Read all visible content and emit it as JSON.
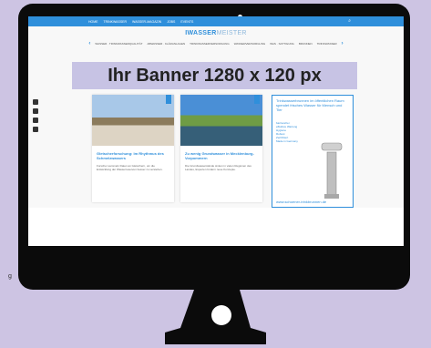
{
  "colors": {
    "brand": "#2f8fdb",
    "banner_bg": "#c7c3e4",
    "page_bg": "#cdc4e3"
  },
  "topbar": {
    "items": [
      "HOME",
      "TRINKWASSER",
      "WASSER-MAGAZIN",
      "JOBS",
      "EVENTS"
    ]
  },
  "site": {
    "logo_bold": "WASSER",
    "logo_thin": "MEISTER",
    "logo_prefix": "I"
  },
  "catnav": {
    "items": [
      "WASSER · TRINKWASSERQUALITÄT",
      "ABWASSER · KLÄRANLAGEN",
      "TRINKWASSERVERSORGUNG",
      "WASSERVERSORGUNG",
      "WAS · SATTIGUNG",
      "BRUNNEN",
      "TRINKWASSER"
    ]
  },
  "banner": {
    "label": "Ihr Banner 1280 x 120 px"
  },
  "social": {
    "icons": [
      "facebook-icon",
      "twitter-icon",
      "linkedin-icon",
      "xing-icon"
    ]
  },
  "cards": [
    {
      "title": "Gletscherforschung: Im Rhythmus des Schmelzwassers",
      "excerpt": "Forscher sammeln Daten an Gletschern, um die Entwicklung der Wasserreserven besser zu verstehen."
    },
    {
      "title": "Zu wenig Grundwasser in Mecklenburg-Vorpommern",
      "excerpt": "Die Grundwasserstände sinken in vielen Regionen des Landes, Experten fordern neue Konzepte."
    }
  ],
  "ad": {
    "headline": "Trinkwasserbrunnen im öffentlichen Raum spendet frisches Wasser für Mensch und Tier",
    "features": [
      "barrierefrei",
      "effektive Wartung",
      "Hygiene",
      "Robust",
      "Zertifiziert",
      "Made in Germany"
    ],
    "url": "www.schoener-trinkbrunnen.de"
  },
  "sidecap": "g"
}
